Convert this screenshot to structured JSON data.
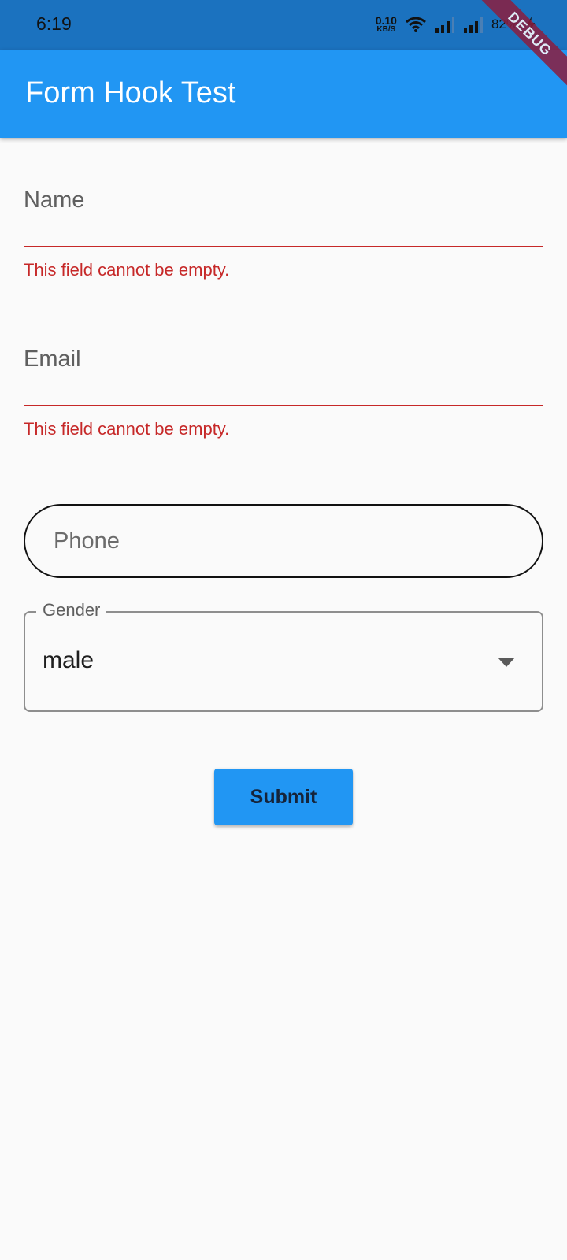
{
  "status_bar": {
    "time": "6:19",
    "net_speed_value": "0.10",
    "net_speed_unit": "KB/S",
    "battery": "82%",
    "icons": [
      "wifi-icon",
      "signal-icon",
      "signal-icon",
      "battery-charging-icon"
    ]
  },
  "debug_banner": {
    "label": "DEBUG"
  },
  "app_bar": {
    "title": "Form Hook Test",
    "color": "#2196f3"
  },
  "form": {
    "name": {
      "label": "Name",
      "error": "This field cannot be empty."
    },
    "email": {
      "label": "Email",
      "error": "This field cannot be empty."
    },
    "phone": {
      "placeholder": "Phone",
      "value": ""
    },
    "gender": {
      "label": "Gender",
      "selected": "male"
    },
    "submit_label": "Submit"
  },
  "colors": {
    "error": "#c62828",
    "primary": "#2196f3",
    "status_bar": "#1b72bf",
    "background": "#fafafa"
  }
}
